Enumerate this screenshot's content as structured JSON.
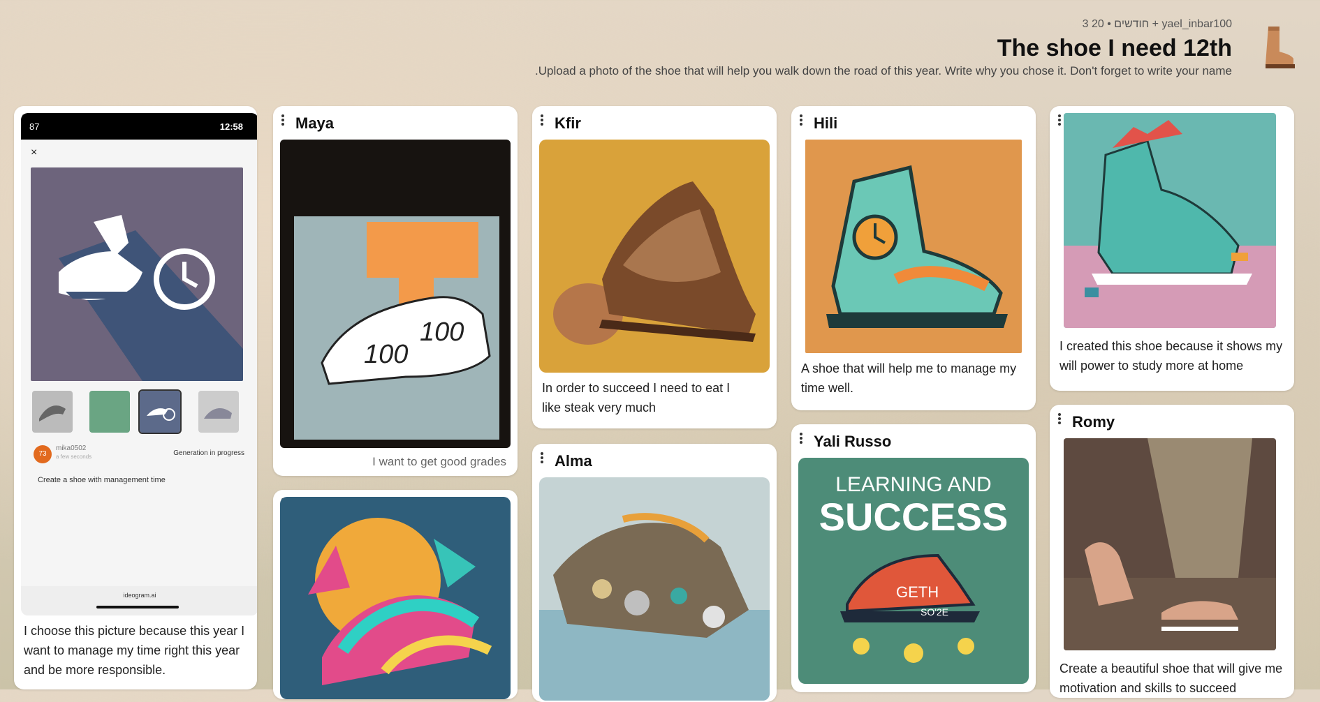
{
  "header": {
    "meta": "3 חודשים • 20 + yael_inbar100",
    "title": "The shoe I need 12th",
    "description": ".Upload a photo of the shoe that will help you walk down the road of this year. Write why you chose it. Don't forget to write your name",
    "icon": "boot-icon"
  },
  "cards": {
    "c1": {
      "phone": {
        "status_left": "87",
        "time": "12:58",
        "close": "×",
        "user": "mika0502",
        "user_sub": "a few seconds",
        "avatar": "73",
        "generation": "Generation in progress",
        "prompt": "Create a shoe with management time",
        "footer": "ideogram.ai"
      },
      "caption": "I choose this picture because this year I want to manage my time right this year and be more responsible."
    },
    "c2": {
      "title": "Maya",
      "caption": "I want to get  good grades"
    },
    "c3": {
      "title": ""
    },
    "c4": {
      "title": "Kfir",
      "caption": "In order to succeed I need to eat I like steak very much"
    },
    "c5": {
      "title": "Alma"
    },
    "c6": {
      "title": "Hili",
      "caption": "A shoe that will help me to manage my time well."
    },
    "c7": {
      "title": "Yali Russo",
      "image_text_1": "LEARNING AND",
      "image_text_2": "SUCCESS",
      "image_text_3": "GETH",
      "image_text_4": "SO'2E"
    },
    "c8": {
      "title": "",
      "caption": "I created this shoe because it shows my will power to study more at home"
    },
    "c9": {
      "title": "Romy",
      "caption": "Create a beautiful shoe that will give me motivation and skills to succeed"
    }
  },
  "colors": {
    "accent": "#e26a1e",
    "card_bg": "#ffffff"
  }
}
